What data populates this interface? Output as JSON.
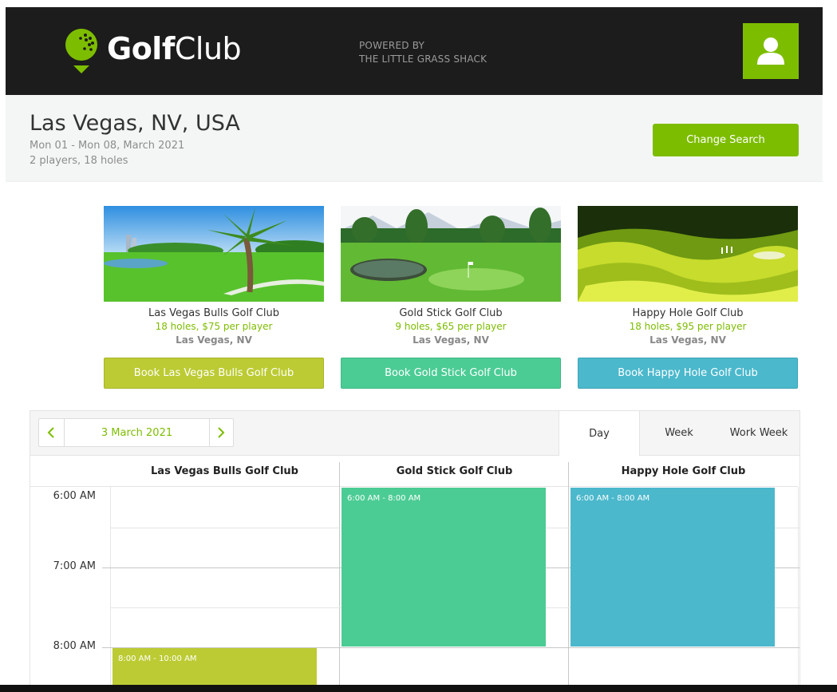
{
  "header": {
    "brand_bold": "Golf",
    "brand_light": "Club",
    "powered_line1": "POWERED BY",
    "powered_line2": "THE LITTLE GRASS SHACK",
    "user_icon": "user-icon"
  },
  "search": {
    "location": "Las Vegas, NV, USA",
    "dates": "Mon 01 - Mon 08, March 2021",
    "details": "2 players, 18 holes",
    "change_label": "Change Search"
  },
  "courses": [
    {
      "name": "Las Vegas Bulls Golf Club",
      "price": "18 holes, $75 per player",
      "city": "Las Vegas, NV",
      "book_label": "Book Las Vegas Bulls Golf Club",
      "color": "#bccb33"
    },
    {
      "name": "Gold Stick Golf Club",
      "price": "9 holes, $65 per player",
      "city": "Las Vegas, NV",
      "book_label": "Book Gold Stick Golf Club",
      "color": "#4ccc95"
    },
    {
      "name": "Happy Hole Golf Club",
      "price": "18 holes, $95 per player",
      "city": "Las Vegas, NV",
      "book_label": "Book Happy Hole Golf Club",
      "color": "#4bb8cc"
    }
  ],
  "scheduler": {
    "current_date": "3 March 2021",
    "views": [
      "Day",
      "Week",
      "Work Week"
    ],
    "active_view": "Day",
    "resources": [
      "Las Vegas Bulls Golf Club",
      "Gold Stick Golf Club",
      "Happy Hole Golf Club"
    ],
    "times": [
      "6:00 AM",
      "7:00 AM",
      "8:00 AM"
    ],
    "events": [
      {
        "resource": "Las Vegas Bulls Golf Club",
        "label": "8:00 AM - 10:00 AM",
        "color": "#bccb33"
      },
      {
        "resource": "Gold Stick Golf Club",
        "label": "6:00 AM - 8:00 AM",
        "color": "#4ccc95"
      },
      {
        "resource": "Happy Hole Golf Club",
        "label": "6:00 AM - 8:00 AM",
        "color": "#4bb8cc"
      }
    ]
  },
  "colors": {
    "accent": "#7dbd00",
    "header_bg": "#1c1c1c"
  }
}
